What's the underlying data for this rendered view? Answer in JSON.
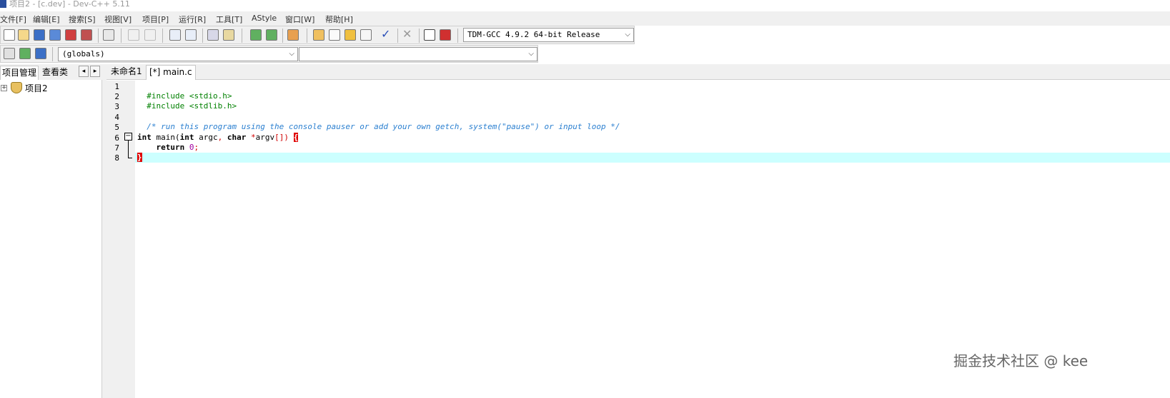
{
  "window": {
    "title": "项目2 - [c.dev] - Dev-C++ 5.11"
  },
  "menu": {
    "items": [
      "文件[F]",
      "编辑[E]",
      "搜索[S]",
      "视图[V]",
      "项目[P]",
      "运行[R]",
      "工具[T]",
      "AStyle",
      "窗口[W]",
      "帮助[H]"
    ]
  },
  "toolbar": {
    "compiler_select": "TDM-GCC 4.9.2 64-bit Release",
    "globals_select": "(globals)",
    "members_select": ""
  },
  "left_panel": {
    "tabs": [
      "项目管理",
      "查看类"
    ],
    "nav_prev": "◂",
    "nav_next": "▸",
    "tree_root": "项目2",
    "expander": "+"
  },
  "editor": {
    "tabs": [
      "未命名1",
      "[*] main.c"
    ],
    "line_numbers": [
      "1",
      "2",
      "3",
      "4",
      "5",
      "6",
      "7",
      "8"
    ],
    "fold_marker": "−",
    "code": {
      "line1": "#include <stdio.h>",
      "line2": "#include <stdlib.h>",
      "line4": "/* run this program using the console pauser or add your own getch, system(\"pause\") or input loop */",
      "line6_kw1": "int",
      "line6_mid1": " main(",
      "line6_kw2": "int",
      "line6_mid2": " argc",
      "line6_comma": ",",
      "line6_sp": " ",
      "line6_kw3": "char",
      "line6_sp2": " ",
      "line6_star": "*",
      "line6_argv": "argv",
      "line6_brackets": "[])",
      "line6_sp3": " ",
      "line6_brace": "{",
      "line7_indent": "    ",
      "line7_kw": "return",
      "line7_sp": " ",
      "line7_num": "0",
      "line7_semi": ";",
      "line8_brace": "}"
    }
  },
  "watermark": "掘金技术社区 @ kee",
  "colors": {
    "current_line": "#ccffff",
    "brace_highlight": "#e00000",
    "preprocessor": "#008000",
    "comment": "#2a7fd0"
  }
}
